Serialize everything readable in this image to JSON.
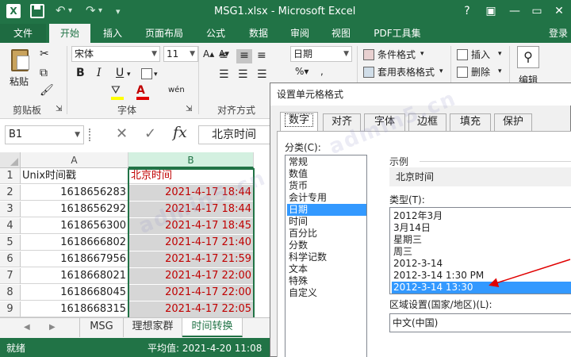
{
  "window": {
    "title": "MSG1.xlsx - Microsoft Excel",
    "user": "登录"
  },
  "tabs": [
    "文件",
    "开始",
    "插入",
    "页面布局",
    "公式",
    "数据",
    "审阅",
    "视图",
    "PDF工具集"
  ],
  "ribbon": {
    "paste_label": "粘贴",
    "font_name": "宋体",
    "font_size": "11",
    "number_format": "日期",
    "conditional_format": "条件格式",
    "table_format": "套用表格格式",
    "insert": "插入",
    "delete": "删除",
    "edit": "编辑",
    "group_clipboard": "剪贴板",
    "group_font": "字体",
    "group_align": "对齐方式",
    "bold": "B",
    "italic": "I",
    "underline": "U",
    "font_color_glyph": "A",
    "phonetic": "wén"
  },
  "formula_bar": {
    "name_box": "B1",
    "fx": "fx",
    "content": "北京时间"
  },
  "sheet": {
    "columns": [
      "A",
      "B"
    ],
    "rows": [
      {
        "n": "1",
        "a": "Unix时间戳",
        "b": "北京时间"
      },
      {
        "n": "2",
        "a": "1618656283",
        "b": "2021-4-17 18:44"
      },
      {
        "n": "3",
        "a": "1618656292",
        "b": "2021-4-17 18:44"
      },
      {
        "n": "4",
        "a": "1618656300",
        "b": "2021-4-17 18:45"
      },
      {
        "n": "5",
        "a": "1618666802",
        "b": "2021-4-17 21:40"
      },
      {
        "n": "6",
        "a": "1618667956",
        "b": "2021-4-17 21:59"
      },
      {
        "n": "7",
        "a": "1618668021",
        "b": "2021-4-17 22:00"
      },
      {
        "n": "8",
        "a": "1618668045",
        "b": "2021-4-17 22:00"
      },
      {
        "n": "9",
        "a": "1618668315",
        "b": "2021-4-17 22:05"
      }
    ],
    "tabs": [
      "MSG",
      "理想家群",
      "时间转换"
    ],
    "active_tab": "时间转换"
  },
  "status": {
    "ready": "就绪",
    "average": "平均值: 2021-4-20 11:08"
  },
  "dialog": {
    "title": "设置单元格格式",
    "tabs": [
      "数字",
      "对齐",
      "字体",
      "边框",
      "填充",
      "保护"
    ],
    "category_label": "分类(C):",
    "categories": [
      "常规",
      "数值",
      "货币",
      "会计专用",
      "日期",
      "时间",
      "百分比",
      "分数",
      "科学记数",
      "文本",
      "特殊",
      "自定义"
    ],
    "selected_category": "日期",
    "sample_label": "示例",
    "sample_value": "北京时间",
    "type_label": "类型(T):",
    "types": [
      "2012年3月",
      "3月14日",
      "星期三",
      "周三",
      "2012-3-14",
      "2012-3-14 1:30 PM",
      "2012-3-14 13:30"
    ],
    "selected_type": "2012-3-14 13:30",
    "locale_label": "区域设置(国家/地区)(L):",
    "locale_value": "中文(中国)"
  },
  "watermark": "admin5.cn",
  "colors": {
    "excel_green": "#217346",
    "selection_blue": "#3399ff",
    "date_red": "#c00000",
    "annotation_red": "#e00000"
  }
}
